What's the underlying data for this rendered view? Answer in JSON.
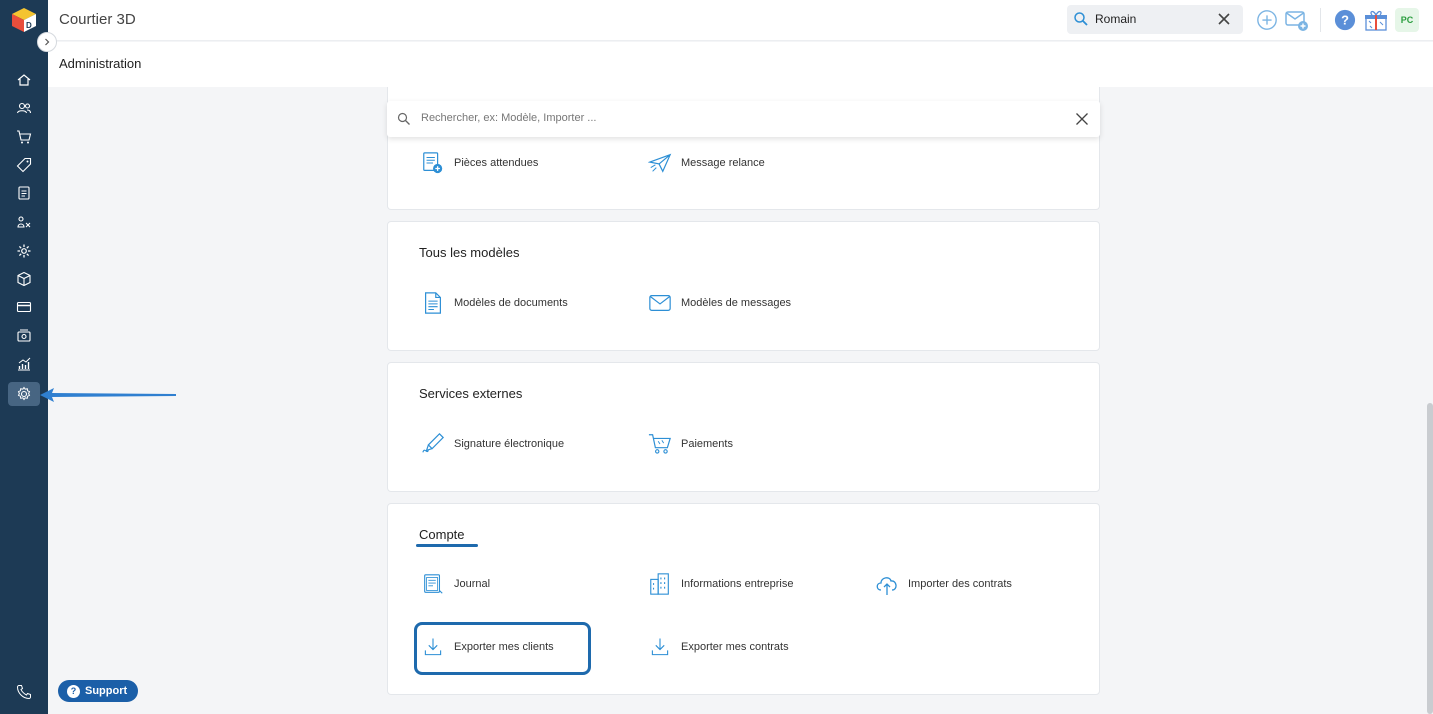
{
  "app": {
    "title": "Courtier 3D"
  },
  "topbar": {
    "search_value": "Romain",
    "avatar_initials": "PC"
  },
  "page": {
    "title": "Administration"
  },
  "search": {
    "placeholder": "Rechercher, ex: Modèle, Importer ..."
  },
  "sections": {
    "first": {
      "items": [
        {
          "label": "Pièces attendues",
          "icon": "document-plus-icon"
        },
        {
          "label": "Message relance",
          "icon": "paper-plane-icon"
        }
      ]
    },
    "modeles": {
      "title": "Tous les modèles",
      "items": [
        {
          "label": "Modèles de documents",
          "icon": "document-icon"
        },
        {
          "label": "Modèles de messages",
          "icon": "envelope-icon"
        }
      ]
    },
    "services": {
      "title": "Services externes",
      "items": [
        {
          "label": "Signature électronique",
          "icon": "signature-pen-icon"
        },
        {
          "label": "Paiements",
          "icon": "cart-icon"
        }
      ]
    },
    "compte": {
      "title": "Compte",
      "items": [
        {
          "label": "Journal",
          "icon": "journal-icon"
        },
        {
          "label": "Informations entreprise",
          "icon": "building-icon"
        },
        {
          "label": "Importer des contrats",
          "icon": "cloud-upload-icon"
        },
        {
          "label": "Exporter mes clients",
          "icon": "download-icon"
        },
        {
          "label": "Exporter mes contrats",
          "icon": "download-icon"
        }
      ]
    }
  },
  "support": {
    "label": "Support"
  },
  "colors": {
    "sidebar": "#1d3a55",
    "accent": "#1e6aad",
    "icon_blue": "#2d8fd5"
  }
}
